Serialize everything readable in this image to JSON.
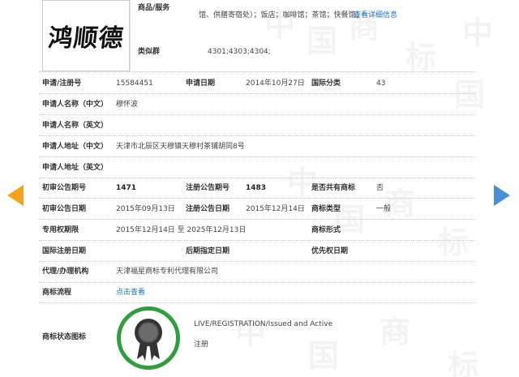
{
  "logo": {
    "text": "鸿顺德"
  },
  "goods": {
    "label": "商品/服务",
    "value": "馆、供膳寄宿处）；饭店；咖啡馆；茶馆；快餐馆；",
    "link": "查看详细信息"
  },
  "similar_group": {
    "label": "类似群",
    "value": "4301;4303;4304;"
  },
  "rows": {
    "reg_no": {
      "label": "申请/注册号",
      "value": "15584451"
    },
    "app_date": {
      "label": "申请日期",
      "value": "2014年10月27日"
    },
    "intl_class": {
      "label": "国际分类",
      "value": "43"
    },
    "applicant_cn": {
      "label": "申请人名称（中文）",
      "value": "穆怀波"
    },
    "applicant_en": {
      "label": "申请人名称（英文）",
      "value": ""
    },
    "address_cn": {
      "label": "申请人地址（中文）",
      "value": "天津市北辰区天穆镇天穆村茶铺胡同8号"
    },
    "address_en": {
      "label": "申请人地址（英文）",
      "value": ""
    },
    "prelim_issue": {
      "label": "初审公告期号",
      "value": "1471"
    },
    "reg_issue": {
      "label": "注册公告期号",
      "value": "1483"
    },
    "shared": {
      "label": "是否共有商标",
      "value": "否"
    },
    "prelim_date": {
      "label": "初审公告日期",
      "value": "2015年09月13日"
    },
    "reg_date": {
      "label": "注册公告日期",
      "value": "2015年12月14日"
    },
    "mark_type": {
      "label": "商标类型",
      "value": "一般"
    },
    "exclusive": {
      "label": "专用权期限",
      "value": "2015年12月14日 至 2025年12月13日"
    },
    "mark_form": {
      "label": "商标形式",
      "value": ""
    },
    "intl_reg_date": {
      "label": "国际注册日期",
      "value": ""
    },
    "later_date": {
      "label": "后期指定日期",
      "value": ""
    },
    "priority_date": {
      "label": "优先权日期",
      "value": ""
    },
    "agent": {
      "label": "代理/办理机构",
      "value": "天津福星商标专利代理有限公司"
    },
    "process": {
      "label": "商标流程",
      "link": "点击查看"
    },
    "status": {
      "label": "商标状态图标",
      "status_en": "LIVE/REGISTRATION/Issued and Active",
      "status_cn": "注册"
    }
  },
  "colors": {
    "link": "#1a73c9",
    "badge_ring": "#2e9e3e",
    "arrow_prev": "#f5a11b",
    "arrow_next": "#4a90d9"
  },
  "icons": {
    "prev": "chevron-left-icon",
    "next": "chevron-right-icon",
    "status": "award-ribbon-icon"
  }
}
